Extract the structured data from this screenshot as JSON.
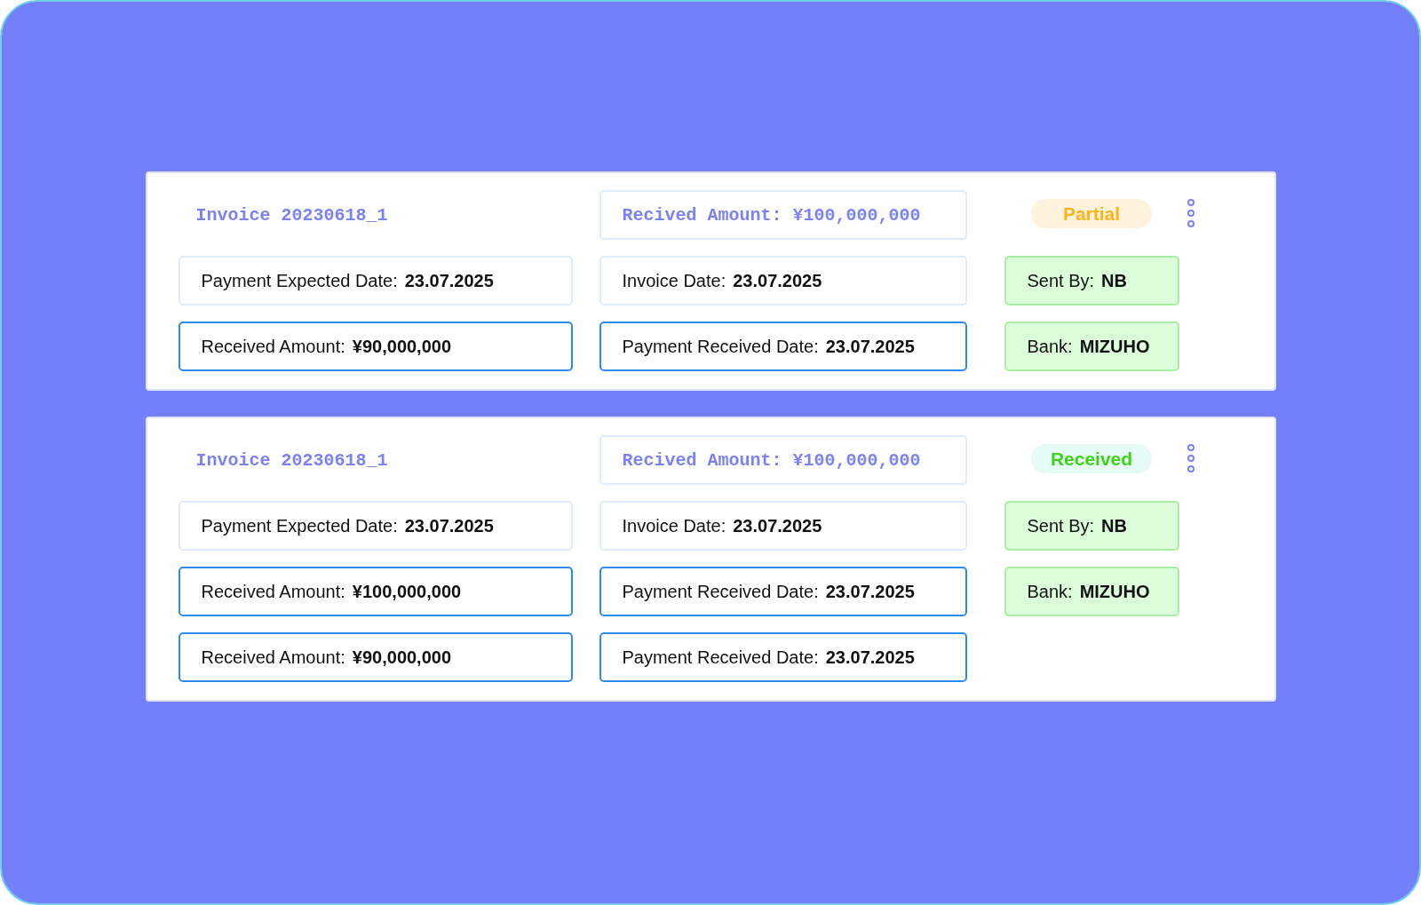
{
  "invoices": [
    {
      "title": "Invoice 20230618_1",
      "header_amount": "Recived Amount: ¥100,000,000",
      "status": {
        "label": "Partial",
        "kind": "partial"
      },
      "rows": [
        [
          {
            "kind": "outline",
            "label": "Payment Expected Date:",
            "value": "23.07.2025"
          },
          {
            "kind": "outline",
            "label": "Invoice Date:",
            "value": "23.07.2025"
          },
          {
            "kind": "tag",
            "label": "Sent By:",
            "value": "NB"
          }
        ],
        [
          {
            "kind": "highlight",
            "label": "Received Amount:",
            "value": "¥90,000,000"
          },
          {
            "kind": "highlight",
            "label": "Payment Received Date:",
            "value": "23.07.2025"
          },
          {
            "kind": "tag",
            "label": "Bank:",
            "value": "MIZUHO"
          }
        ]
      ]
    },
    {
      "title": "Invoice 20230618_1",
      "header_amount": "Recived Amount: ¥100,000,000",
      "status": {
        "label": "Received",
        "kind": "received"
      },
      "rows": [
        [
          {
            "kind": "outline",
            "label": "Payment Expected Date:",
            "value": "23.07.2025"
          },
          {
            "kind": "outline",
            "label": "Invoice Date:",
            "value": "23.07.2025"
          },
          {
            "kind": "tag",
            "label": "Sent By:",
            "value": "NB"
          }
        ],
        [
          {
            "kind": "highlight",
            "label": "Received Amount:",
            "value": "¥100,000,000"
          },
          {
            "kind": "highlight",
            "label": "Payment Received Date:",
            "value": "23.07.2025"
          },
          {
            "kind": "tag",
            "label": "Bank:",
            "value": "MIZUHO"
          }
        ],
        [
          {
            "kind": "highlight",
            "label": "Received Amount:",
            "value": "¥90,000,000"
          },
          {
            "kind": "highlight",
            "label": "Payment Received Date:",
            "value": "23.07.2025"
          }
        ]
      ]
    }
  ]
}
